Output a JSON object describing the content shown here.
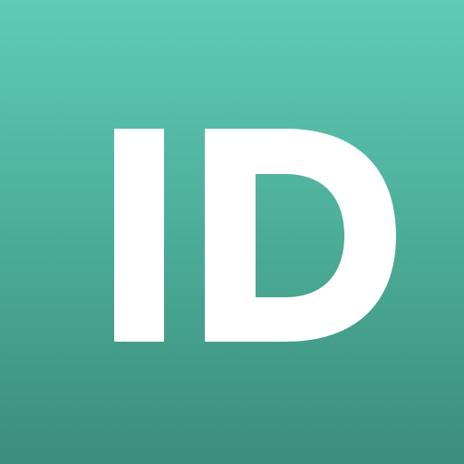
{
  "icon": {
    "name": "ID",
    "colors": {
      "gradient_top": "#5FCCB6",
      "gradient_bottom": "#3A8E7A",
      "glyph": "#FFFFFF"
    }
  }
}
